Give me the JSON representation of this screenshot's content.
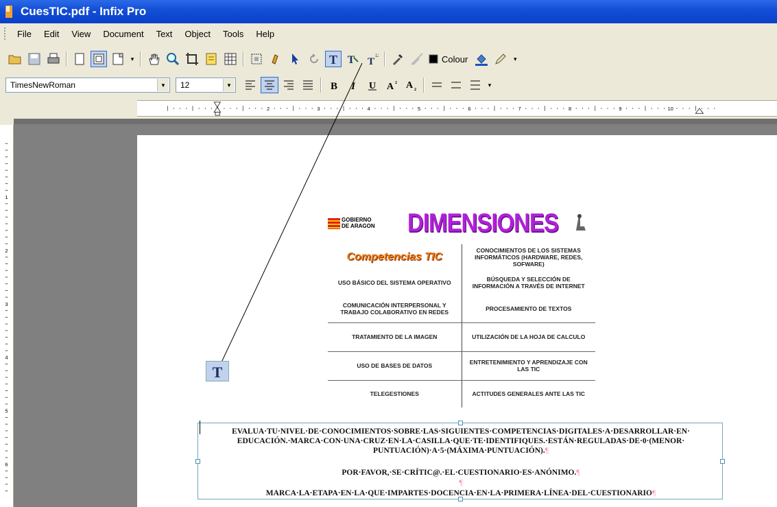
{
  "window": {
    "title": "CuesTIC.pdf - Infix Pro"
  },
  "menu": [
    "File",
    "Edit",
    "View",
    "Document",
    "Text",
    "Object",
    "Tools",
    "Help"
  ],
  "toolbar": {
    "colour_label": "Colour"
  },
  "format_bar": {
    "font": "TimesNewRoman",
    "size": "12"
  },
  "ruler": {
    "h_numbers": [
      "1",
      "2",
      "3",
      "4",
      "5",
      "6",
      "7",
      "8",
      "9",
      "10"
    ],
    "v_numbers": [
      "1",
      "2",
      "3",
      "4",
      "5",
      "6"
    ]
  },
  "figure": {
    "logo_text": "GOBIERNO\nDE ARAGON",
    "title": "DIMENSIONES",
    "competencias": "Competencias TIC",
    "rows": [
      {
        "left": "",
        "right": "CONOCIMIENTOS DE LOS SISTEMAS INFORMÁTICOS (HARDWARE, REDES, SOFWARE)"
      },
      {
        "left": "USO BÁSICO DEL SISTEMA OPERATIVO",
        "right": "BÚSQUEDA Y SELECCIÓN DE INFORMACIÓN A TRAVÉS DE INTERNET"
      },
      {
        "left": "COMUNICACIÓN INTERPERSONAL Y TRABAJO COLABORATIVO EN REDES",
        "right": "PROCESAMIENTO DE TEXTOS"
      },
      {
        "left": "TRATAMIENTO DE LA IMAGEN",
        "right": "UTILIZACIÓN DE LA HOJA DE CALCULO"
      },
      {
        "left": "USO DE BASES DE DATOS",
        "right": "ENTRETENIMIENTO Y APRENDIZAJE CON LAS TIC"
      },
      {
        "left": "TELEGESTIONES",
        "right": "ACTITUDES GENERALES ANTE LAS TIC"
      }
    ]
  },
  "textbox": {
    "line1": "EVALUA·TU·NIVEL·DE·CONOCIMIENTOS·SOBRE·LAS·SIGUIENTES·COMPETENCIAS·DIGITALES·A·DESARROLLAR·EN·",
    "line2": "EDUCACIÓN.·MARCA·CON·UNA·CRUZ·EN·LA·CASILLA·QUE·TE·IDENTIFIQUES.·ESTÁN·REGULADAS·DE·0·(MENOR·",
    "line3": "PUNTUACIÓN)·A·5·(MÁXIMA·PUNTUACIÓN).",
    "line4": "POR·FAVOR,·SE·CRÍTIC@.·EL·CUESTIONARIO·ES·ANÓNIMO.",
    "line5": "MARCA·LA·ETAPA·EN·LA·QUE·IMPARTES·DOCENCIA·EN·LA·PRIMERA·LÍNEA·DEL·CUESTIONARIO",
    "pilcrow": "¶"
  }
}
